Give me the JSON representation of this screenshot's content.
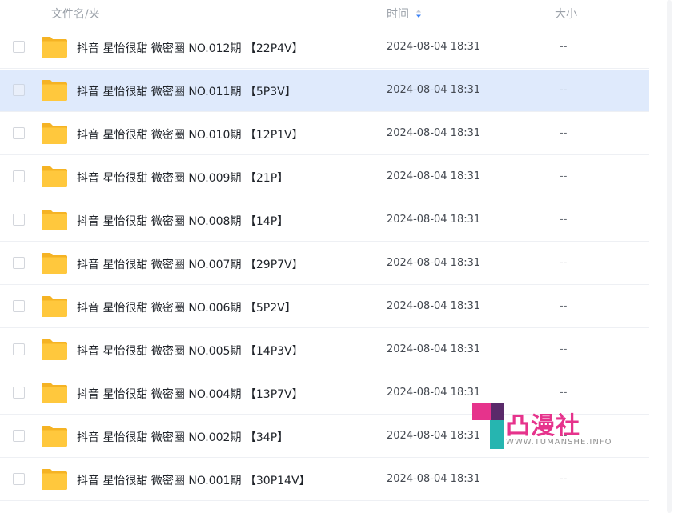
{
  "header": {
    "name_label": "文件名/夹",
    "time_label": "时间",
    "size_label": "大小",
    "sort_icon": "sort-down-icon"
  },
  "files": [
    {
      "name": "抖音 星怡很甜 微密圈 NO.012期 【22P4V】",
      "time": "2024-08-04 18:31",
      "size": "--",
      "selected": false
    },
    {
      "name": "抖音 星怡很甜 微密圈 NO.011期 【5P3V】",
      "time": "2024-08-04 18:31",
      "size": "--",
      "selected": true
    },
    {
      "name": "抖音 星怡很甜 微密圈 NO.010期 【12P1V】",
      "time": "2024-08-04 18:31",
      "size": "--",
      "selected": false
    },
    {
      "name": "抖音 星怡很甜 微密圈 NO.009期 【21P】",
      "time": "2024-08-04 18:31",
      "size": "--",
      "selected": false
    },
    {
      "name": "抖音 星怡很甜 微密圈 NO.008期 【14P】",
      "time": "2024-08-04 18:31",
      "size": "--",
      "selected": false
    },
    {
      "name": "抖音 星怡很甜 微密圈 NO.007期 【29P7V】",
      "time": "2024-08-04 18:31",
      "size": "--",
      "selected": false
    },
    {
      "name": "抖音 星怡很甜 微密圈 NO.006期 【5P2V】",
      "time": "2024-08-04 18:31",
      "size": "--",
      "selected": false
    },
    {
      "name": "抖音 星怡很甜 微密圈 NO.005期 【14P3V】",
      "time": "2024-08-04 18:31",
      "size": "--",
      "selected": false
    },
    {
      "name": "抖音 星怡很甜 微密圈 NO.004期 【13P7V】",
      "time": "2024-08-04 18:31",
      "size": "--",
      "selected": false
    },
    {
      "name": "抖音 星怡很甜 微密圈 NO.002期 【34P】",
      "time": "2024-08-04 18:31",
      "size": "--",
      "selected": false
    },
    {
      "name": "抖音 星怡很甜 微密圈 NO.001期 【30P14V】",
      "time": "2024-08-04 18:31",
      "size": "--",
      "selected": false
    }
  ],
  "watermark": {
    "text": "凸漫社",
    "url": "WWW.TUMANSHE.INFO"
  },
  "colors": {
    "selected_row": "#dfeafc",
    "folder": "#ffc83d",
    "folder_back": "#f5b324",
    "sort_accent": "#3b82f6",
    "watermark_pink": "#e6338c",
    "watermark_teal": "#26b5b0"
  }
}
